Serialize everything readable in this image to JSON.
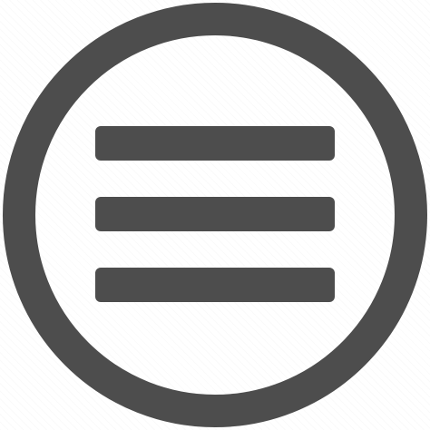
{
  "icon": {
    "name": "hamburger-menu-circle-icon",
    "color": "#4d4d4d",
    "background": "#ffffff"
  }
}
